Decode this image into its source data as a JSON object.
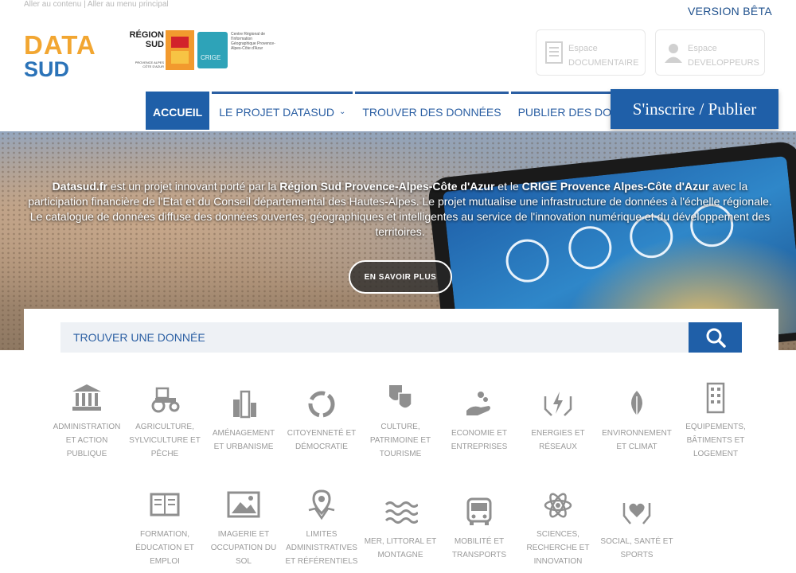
{
  "skip_links": {
    "content": "Aller au contenu",
    "separator": "|",
    "menu": "Aller au menu principal"
  },
  "version": "VERSION BÊTA",
  "logo": {
    "line1": "DATA",
    "line2": "SUD"
  },
  "partner": {
    "region_name": "RÉGION SUD",
    "region_sub": "PROVENCE ALPES CÔTE D'AZUR",
    "crige_label": "CRIGE",
    "crige_text": "Centre Régional de l'Information Géographique Provence-Alpes-Côte d'Azur"
  },
  "espaces": [
    {
      "line1": "Espace",
      "line2": "DOCUMENTAIRE",
      "icon": "document-icon"
    },
    {
      "line1": "Espace",
      "line2": "DEVELOPPEURS",
      "icon": "user-icon"
    }
  ],
  "nav": {
    "items": [
      {
        "label": "ACCUEIL",
        "active": true
      },
      {
        "label": "LE PROJET DATASUD",
        "chevron": "⌄"
      },
      {
        "label": "TROUVER DES DONNÉES"
      },
      {
        "label": "PUBLIER DES DONNÉES"
      }
    ],
    "cta": "S'inscrire / Publier"
  },
  "hero": {
    "p1": "Datasud.fr",
    "p2": " est un projet innovant porté par la ",
    "p3": "Région Sud Provence-Alpes-Côte d'Azur",
    "p4": " et le ",
    "p5": "CRIGE Provence Alpes-Côte d'Azur",
    "p6": " avec la participation financière de l'Etat et du Conseil départemental des Hautes-Alpes. Le projet mutualise une infrastructure de données à l'échelle régionale. Le catalogue de données diffuse des données ouvertes, géographiques et intelligentes au service de l'innovation numérique et du développement des territoires.",
    "button": "EN SAVOIR PLUS"
  },
  "search": {
    "placeholder": "TROUVER UNE DONNÉE"
  },
  "colors": {
    "primary": "#1f5fa8",
    "orange": "#f2a631",
    "sud_blue": "#2b73b8",
    "icon_grey": "#8f8f8f"
  },
  "categories": [
    {
      "label": "ADMINISTRATION ET ACTION PUBLIQUE",
      "l1": "ADMINISTRATION",
      "l2": "ET ACTION",
      "l3": "PUBLIQUE",
      "icon": "bank-icon"
    },
    {
      "label": "AGRICULTURE, SYLVICULTURE ET PÊCHE",
      "l1": "AGRICULTURE,",
      "l2": "SYLVICULTURE ET",
      "l3": "PÊCHE",
      "icon": "tractor-icon"
    },
    {
      "label": "AMÉNAGEMENT ET URBANISME",
      "l1": "AMÉNAGEMENT",
      "l2": "ET URBANISME",
      "icon": "buildings-icon"
    },
    {
      "label": "CITOYENNETÉ ET DÉMOCRATIE",
      "l1": "CITOYENNETÉ ET",
      "l2": "DÉMOCRATIE",
      "icon": "ring-icon"
    },
    {
      "label": "CULTURE, PATRIMOINE ET TOURISME",
      "l1": "CULTURE,",
      "l2": "PATRIMOINE ET",
      "l3": "TOURISME",
      "icon": "theatre-masks-icon"
    },
    {
      "label": "ECONOMIE ET ENTREPRISES",
      "l1": "ECONOMIE ET",
      "l2": "ENTREPRISES",
      "icon": "hand-coins-icon"
    },
    {
      "label": "ENERGIES ET RÉSEAUX",
      "l1": "ENERGIES ET",
      "l2": "RÉSEAUX",
      "icon": "hands-energy-icon"
    },
    {
      "label": "ENVIRONNEMENT ET CLIMAT",
      "l1": "ENVIRONNEMENT",
      "l2": "ET CLIMAT",
      "icon": "leaf-icon"
    },
    {
      "label": "EQUIPEMENTS, BÂTIMENTS ET LOGEMENT",
      "l1": "EQUIPEMENTS,",
      "l2": "BÂTIMENTS ET",
      "l3": "LOGEMENT",
      "icon": "building-icon"
    },
    {
      "label": "FORMATION, ÉDUCATION ET EMPLOI",
      "l1": "FORMATION,",
      "l2": "ÉDUCATION ET",
      "l3": "EMPLOI",
      "icon": "book-icon"
    },
    {
      "label": "IMAGERIE ET OCCUPATION DU SOL",
      "l1": "IMAGERIE ET",
      "l2": "OCCUPATION DU",
      "l3": "SOL",
      "icon": "image-icon"
    },
    {
      "label": "LIMITES ADMINISTRATIVES ET RÉFÉRENTIELS",
      "l1": "LIMITES",
      "l2": "ADMINISTRATIVES",
      "l3": "ET RÉFÉRENTIELS",
      "icon": "map-pin-icon"
    },
    {
      "label": "MER, LITTORAL ET MONTAGNE",
      "l1": "MER, LITTORAL ET",
      "l2": "MONTAGNE",
      "icon": "waves-icon"
    },
    {
      "label": "MOBILITÉ ET TRANSPORTS",
      "l1": "MOBILITÉ ET",
      "l2": "TRANSPORTS",
      "icon": "bus-icon"
    },
    {
      "label": "SCIENCES, RECHERCHE ET INNOVATION",
      "l1": "SCIENCES,",
      "l2": "RECHERCHE ET",
      "l3": "INNOVATION",
      "icon": "atom-icon"
    },
    {
      "label": "SOCIAL, SANTÉ ET SPORTS",
      "l1": "SOCIAL, SANTÉ ET",
      "l2": "SPORTS",
      "icon": "hands-heart-icon"
    }
  ]
}
